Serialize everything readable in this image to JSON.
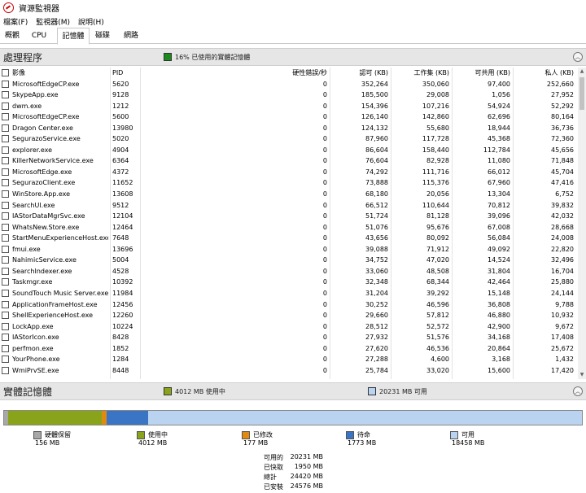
{
  "window": {
    "title": "資源監視器"
  },
  "menu": [
    "檔案(F)",
    "監視器(M)",
    "說明(H)"
  ],
  "tabs": [
    {
      "label": "概觀",
      "active": false
    },
    {
      "label": "CPU",
      "active": false
    },
    {
      "label": "記憶體",
      "active": true
    },
    {
      "label": "磁碟",
      "active": false
    },
    {
      "label": "網路",
      "active": false
    }
  ],
  "processes": {
    "title": "處理程序",
    "usage_text": "16% 已使用的實體記憶體",
    "usage_color": "#1a8a1a",
    "columns": {
      "image": "影像",
      "pid": "PID",
      "hard_faults": "硬性錯誤/秒",
      "commit": "認可 (KB)",
      "working_set": "工作集 (KB)",
      "shareable": "可共用 (KB)",
      "private": "私人 (KB)"
    },
    "rows": [
      [
        "MicrosoftEdgeCP.exe",
        "5620",
        "0",
        "352,264",
        "350,060",
        "97,400",
        "252,660"
      ],
      [
        "SkypeApp.exe",
        "9128",
        "0",
        "185,500",
        "29,008",
        "1,056",
        "27,952"
      ],
      [
        "dwm.exe",
        "1212",
        "0",
        "154,396",
        "107,216",
        "54,924",
        "52,292"
      ],
      [
        "MicrosoftEdgeCP.exe",
        "5600",
        "0",
        "126,140",
        "142,860",
        "62,696",
        "80,164"
      ],
      [
        "Dragon Center.exe",
        "13980",
        "0",
        "124,132",
        "55,680",
        "18,944",
        "36,736"
      ],
      [
        "SegurazoService.exe",
        "5020",
        "0",
        "87,960",
        "117,728",
        "45,368",
        "72,360"
      ],
      [
        "explorer.exe",
        "4904",
        "0",
        "86,604",
        "158,440",
        "112,784",
        "45,656"
      ],
      [
        "KillerNetworkService.exe",
        "6364",
        "0",
        "76,604",
        "82,928",
        "11,080",
        "71,848"
      ],
      [
        "MicrosoftEdge.exe",
        "4372",
        "0",
        "74,292",
        "111,716",
        "66,012",
        "45,704"
      ],
      [
        "SegurazoClient.exe",
        "11652",
        "0",
        "73,888",
        "115,376",
        "67,960",
        "47,416"
      ],
      [
        "WinStore.App.exe",
        "13608",
        "0",
        "68,180",
        "20,056",
        "13,304",
        "6,752"
      ],
      [
        "SearchUI.exe",
        "9512",
        "0",
        "66,512",
        "110,644",
        "70,812",
        "39,832"
      ],
      [
        "IAStorDataMgrSvc.exe",
        "12104",
        "0",
        "51,724",
        "81,128",
        "39,096",
        "42,032"
      ],
      [
        "WhatsNew.Store.exe",
        "12464",
        "0",
        "51,076",
        "95,676",
        "67,008",
        "28,668"
      ],
      [
        "StartMenuExperienceHost.exe",
        "7648",
        "0",
        "43,656",
        "80,092",
        "56,084",
        "24,008"
      ],
      [
        "fmui.exe",
        "13696",
        "0",
        "39,088",
        "71,912",
        "49,092",
        "22,820"
      ],
      [
        "NahimicService.exe",
        "5004",
        "0",
        "34,752",
        "47,020",
        "14,524",
        "32,496"
      ],
      [
        "SearchIndexer.exe",
        "4528",
        "0",
        "33,060",
        "48,508",
        "31,804",
        "16,704"
      ],
      [
        "Taskmgr.exe",
        "10392",
        "0",
        "32,348",
        "68,344",
        "42,464",
        "25,880"
      ],
      [
        "SoundTouch Music Server.exe",
        "11984",
        "0",
        "31,204",
        "39,292",
        "15,148",
        "24,144"
      ],
      [
        "ApplicationFrameHost.exe",
        "12456",
        "0",
        "30,252",
        "46,596",
        "36,808",
        "9,788"
      ],
      [
        "ShellExperienceHost.exe",
        "12260",
        "0",
        "29,660",
        "57,812",
        "46,880",
        "10,932"
      ],
      [
        "LockApp.exe",
        "10224",
        "0",
        "28,512",
        "52,572",
        "42,900",
        "9,672"
      ],
      [
        "IAStorIcon.exe",
        "8428",
        "0",
        "27,932",
        "51,576",
        "34,168",
        "17,408"
      ],
      [
        "perfmon.exe",
        "1852",
        "0",
        "27,620",
        "46,536",
        "20,864",
        "25,672"
      ],
      [
        "YourPhone.exe",
        "1284",
        "0",
        "27,288",
        "4,600",
        "3,168",
        "1,432"
      ],
      [
        "WmiPrvSE.exe",
        "8448",
        "0",
        "25,784",
        "33,020",
        "15,600",
        "17,420"
      ]
    ]
  },
  "physical_memory": {
    "title": "實體記憶體",
    "in_use_text": "4012 MB 使用中",
    "available_text": "20231 MB 可用",
    "legend": [
      {
        "name": "硬體保留",
        "value": "156 MB",
        "color": "#a8a8a8",
        "mb": 156
      },
      {
        "name": "使用中",
        "value": "4012 MB",
        "color": "#89a41a",
        "mb": 4012
      },
      {
        "name": "已修改",
        "value": "177 MB",
        "color": "#e08a10",
        "mb": 177
      },
      {
        "name": "待命",
        "value": "1773 MB",
        "color": "#3a74c4",
        "mb": 1773
      },
      {
        "name": "可用",
        "value": "18458 MB",
        "color": "#b9d3f0",
        "mb": 18458
      }
    ],
    "summary": [
      {
        "label": "可用的",
        "value": "20231 MB"
      },
      {
        "label": "已快取",
        "value": "1950 MB"
      },
      {
        "label": "總計",
        "value": "24420 MB"
      },
      {
        "label": "已安裝",
        "value": "24576 MB"
      }
    ]
  }
}
